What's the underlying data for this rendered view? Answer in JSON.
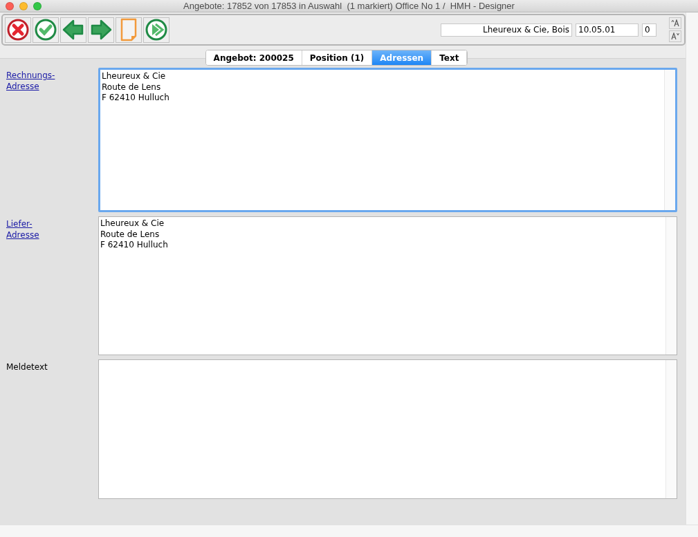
{
  "window": {
    "title": "Angebote: 17852 von 17853 in Auswahl  (1 markiert) Office No 1 /  HMH - Designer"
  },
  "toolbar": {
    "buttons": [
      {
        "kind": "cancel"
      },
      {
        "kind": "confirm"
      },
      {
        "kind": "previous"
      },
      {
        "kind": "next"
      },
      {
        "kind": "new"
      },
      {
        "kind": "forward"
      }
    ],
    "fields": [
      {
        "kind": "customer",
        "value": "Lheureux & Cie, Bois"
      },
      {
        "kind": "date",
        "value": "10.05.01"
      },
      {
        "kind": "count",
        "value": "0"
      }
    ],
    "font_buttons": [
      {
        "kind": "larger"
      },
      {
        "kind": "smaller"
      }
    ]
  },
  "tabs": [
    {
      "label": "Angebot: 200025",
      "selected": false
    },
    {
      "label": "Position (1)",
      "selected": false
    },
    {
      "label": "Adressen",
      "selected": true
    },
    {
      "label": "Text",
      "selected": false
    }
  ],
  "sections": [
    {
      "label_lines": [
        "Rechnungs-",
        "Adresse"
      ],
      "kind": "link",
      "focused": true,
      "lines": [
        "Lheureux & Cie",
        "Route de Lens",
        "F 62410 Hulluch"
      ]
    },
    {
      "label_lines": [
        "Liefer-",
        "Adresse"
      ],
      "kind": "link",
      "focused": false,
      "lines": [
        "Lheureux & Cie",
        "Route de Lens",
        "F 62410 Hulluch"
      ]
    },
    {
      "label_lines": [
        "Meldetext"
      ],
      "kind": "plain",
      "focused": false
    }
  ]
}
